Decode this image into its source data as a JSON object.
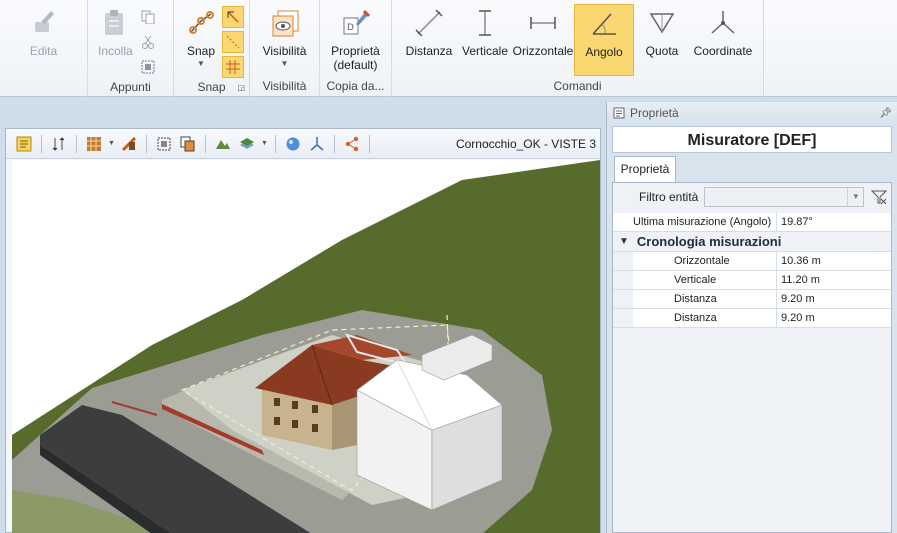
{
  "ribbon": {
    "modifica": {
      "edita_label": "Edita"
    },
    "appunti": {
      "incolla_label": "Incolla",
      "group_label": "Appunti"
    },
    "snap": {
      "snap_label": "Snap",
      "group_label": "Snap"
    },
    "visibilita": {
      "visibilita_label": "Visibilità",
      "group_label": "Visibilità"
    },
    "copia": {
      "proprieta_label": "Proprietà",
      "proprieta_sub": "(default)",
      "group_label": "Copia da..."
    },
    "comandi": {
      "group_label": "Comandi",
      "items": [
        {
          "label": "Distanza",
          "icon": "distance-icon"
        },
        {
          "label": "Verticale",
          "icon": "vertical-icon"
        },
        {
          "label": "Orizzontale",
          "icon": "horizontal-icon"
        },
        {
          "label": "Angolo",
          "icon": "angle-icon",
          "active": true
        },
        {
          "label": "Quota",
          "icon": "elevation-icon"
        },
        {
          "label": "Coordinate",
          "icon": "coordinate-icon"
        }
      ]
    }
  },
  "viewport": {
    "title": "Cornocchio_OK -  VISTE 3"
  },
  "properties": {
    "panel_title": "Proprietà",
    "header": "Misuratore [DEF]",
    "tab_label": "Proprietà",
    "filter_label": "Filtro entità",
    "last_measure": {
      "key": "Ultima misurazione (Angolo)",
      "value": "19.87°"
    },
    "history_label": "Cronologia misurazioni",
    "history": [
      {
        "key": "Orizzontale",
        "value": "10.36 m"
      },
      {
        "key": "Verticale",
        "value": "11.20 m"
      },
      {
        "key": "Distanza",
        "value": "9.20 m"
      },
      {
        "key": "Distanza",
        "value": "9.20 m"
      }
    ]
  },
  "colors": {
    "accent_active": "#fbd772",
    "panel_bg": "#d9e3ee",
    "terrain_green": "#566b2c"
  }
}
